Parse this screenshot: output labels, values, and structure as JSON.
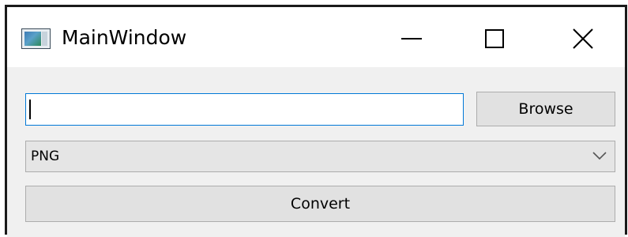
{
  "window": {
    "title": "MainWindow",
    "icon": "app-window-icon",
    "caption_buttons": {
      "minimize_icon": "minimize-icon",
      "maximize_icon": "maximize-icon",
      "close_icon": "close-icon"
    }
  },
  "form": {
    "path_input": {
      "value": "",
      "placeholder": ""
    },
    "browse_label": "Browse",
    "format_select": {
      "selected": "PNG",
      "icon": "chevron-down-icon"
    },
    "convert_label": "Convert"
  },
  "colors": {
    "focus_border": "#0078d7",
    "button_face": "#e1e1e1",
    "window_bg": "#f0f0f0"
  }
}
